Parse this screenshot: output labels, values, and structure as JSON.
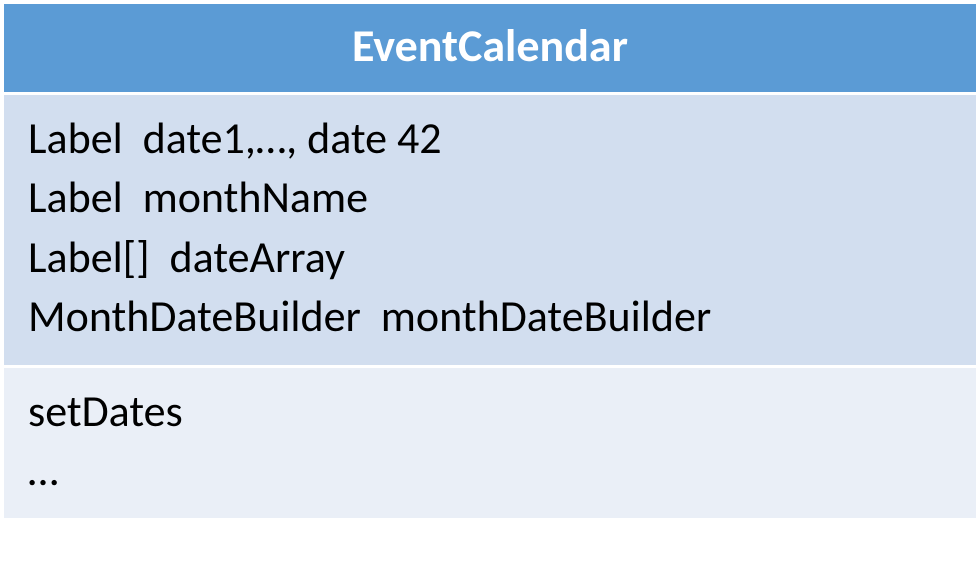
{
  "class": {
    "name": "EventCalendar",
    "attributes": [
      "Label  date1,…, date 42",
      "Label  monthName",
      "Label[]  dateArray",
      "MonthDateBuilder  monthDateBuilder"
    ],
    "methods": [
      "setDates",
      "…"
    ]
  }
}
